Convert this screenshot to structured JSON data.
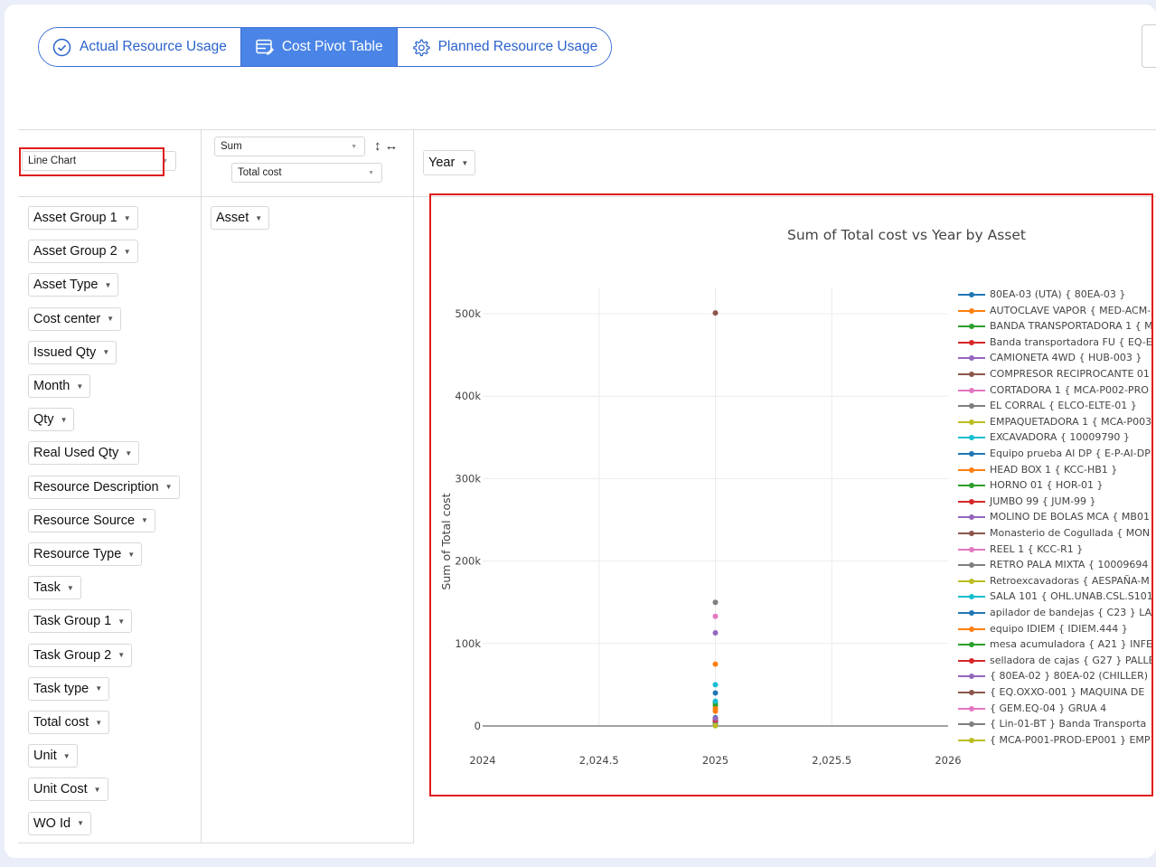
{
  "tabs": [
    {
      "label": "Actual Resource Usage",
      "icon": "check-circle-icon",
      "active": false
    },
    {
      "label": "Cost Pivot Table",
      "icon": "table-edit-icon",
      "active": true
    },
    {
      "label": "Planned Resource Usage",
      "icon": "gear-icon",
      "active": false
    }
  ],
  "renderer": {
    "selected": "Line Chart"
  },
  "aggregator": {
    "selected": "Sum",
    "value_field": "Total cost"
  },
  "col_attr": {
    "label": "Year"
  },
  "row_attr": {
    "label": "Asset"
  },
  "unused_attrs": [
    "Asset Group 1",
    "Asset Group 2",
    "Asset Type",
    "Cost center",
    "Issued Qty",
    "Month",
    "Qty",
    "Real Used Qty",
    "Resource Description",
    "Resource Source",
    "Resource Type",
    "Task",
    "Task Group 1",
    "Task Group 2",
    "Task type",
    "Total cost",
    "Unit",
    "Unit Cost",
    "WO Id"
  ],
  "colors": {
    "accent": "#4a84e6",
    "highlight_border": "#e01b1b"
  },
  "chart_data": {
    "type": "line",
    "title": "Sum of Total cost vs Year by Asset",
    "xlabel": "",
    "ylabel": "Sum of Total cost",
    "xlim": [
      2024,
      2026
    ],
    "ylim": [
      0,
      500000
    ],
    "x_ticks": [
      "2024",
      "2,024.5",
      "2025",
      "2,025.5",
      "2026"
    ],
    "y_ticks": [
      "0",
      "100k",
      "200k",
      "300k",
      "400k",
      "500k"
    ],
    "legend_position": "right",
    "x": [
      2025
    ],
    "series": [
      {
        "name": "80EA-03 (UTA) { 80EA-03 }",
        "color": "#1f77b4",
        "values": [
          40000
        ]
      },
      {
        "name": "AUTOCLAVE VAPOR { MED-ACM-",
        "color": "#ff7f0e",
        "values": [
          75000
        ]
      },
      {
        "name": "BANDA TRANSPORTADORA 1 { M",
        "color": "#2ca02c",
        "values": [
          25000
        ]
      },
      {
        "name": "Banda transportadora FU { EQ-E",
        "color": "#d62728",
        "values": [
          8000
        ]
      },
      {
        "name": "CAMIONETA 4WD { HUB-003 }",
        "color": "#9467bd",
        "values": [
          113000
        ]
      },
      {
        "name": "COMPRESOR RECIPROCANTE 01",
        "color": "#8c564b",
        "values": [
          501000
        ]
      },
      {
        "name": "CORTADORA 1 { MCA-P002-PRO",
        "color": "#e377c2",
        "values": [
          133000
        ]
      },
      {
        "name": "EL CORRAL { ELCO-ELTE-01 }",
        "color": "#7f7f7f",
        "values": [
          150000
        ]
      },
      {
        "name": "EMPAQUETADORA 1 { MCA-P003",
        "color": "#bcbd22",
        "values": [
          3000
        ]
      },
      {
        "name": "EXCAVADORA { 10009790 }",
        "color": "#17becf",
        "values": [
          50000
        ]
      },
      {
        "name": "Equipo prueba AI DP { E-P-AI-DP",
        "color": "#1f77b4",
        "values": [
          10000
        ]
      },
      {
        "name": "HEAD BOX 1 { KCC-HB1 }",
        "color": "#ff7f0e",
        "values": [
          18000
        ]
      },
      {
        "name": "HORNO 01 { HOR-01 }",
        "color": "#2ca02c",
        "values": [
          28000
        ]
      },
      {
        "name": "JUMBO 99 { JUM-99 }",
        "color": "#d62728",
        "values": [
          6000
        ]
      },
      {
        "name": "MOLINO DE BOLAS MCA { MB01",
        "color": "#9467bd",
        "values": [
          5000
        ]
      },
      {
        "name": "Monasterio de Cogullada { MON",
        "color": "#8c564b",
        "values": [
          2000
        ]
      },
      {
        "name": "REEL 1 { KCC-R1 }",
        "color": "#e377c2",
        "values": [
          4000
        ]
      },
      {
        "name": "RETRO PALA MIXTA { 10009694",
        "color": "#7f7f7f",
        "values": [
          1500
        ]
      },
      {
        "name": "Retroexcavadoras { AESPAÑA-M",
        "color": "#bcbd22",
        "values": [
          1000
        ]
      },
      {
        "name": "SALA 101 { OHL.UNAB.CSL.S101",
        "color": "#17becf",
        "values": [
          30000
        ]
      },
      {
        "name": "apilador de bandejas { C23 } LA",
        "color": "#1f77b4",
        "values": [
          3500
        ]
      },
      {
        "name": "equipo IDIEM { IDIEM.444 }",
        "color": "#ff7f0e",
        "values": [
          21000
        ]
      },
      {
        "name": "mesa acumuladora { A21 } INFE",
        "color": "#2ca02c",
        "values": [
          2500
        ]
      },
      {
        "name": "selladora de cajas { G27 } PALLE",
        "color": "#d62728",
        "values": [
          7000
        ]
      },
      {
        "name": "{ 80EA-02 } 80EA-02 (CHILLER)",
        "color": "#9467bd",
        "values": [
          9000
        ]
      },
      {
        "name": "{ EQ.OXXO-001 } MAQUINA DE",
        "color": "#8c564b",
        "values": [
          500
        ]
      },
      {
        "name": "{ GEM.EQ-04 } GRUA 4",
        "color": "#e377c2",
        "values": [
          1200
        ]
      },
      {
        "name": "{ Lin-01-BT } Banda Transporta",
        "color": "#7f7f7f",
        "values": [
          800
        ]
      },
      {
        "name": "{ MCA-P001-PROD-EP001 } EMP",
        "color": "#bcbd22",
        "values": [
          300
        ]
      }
    ]
  }
}
